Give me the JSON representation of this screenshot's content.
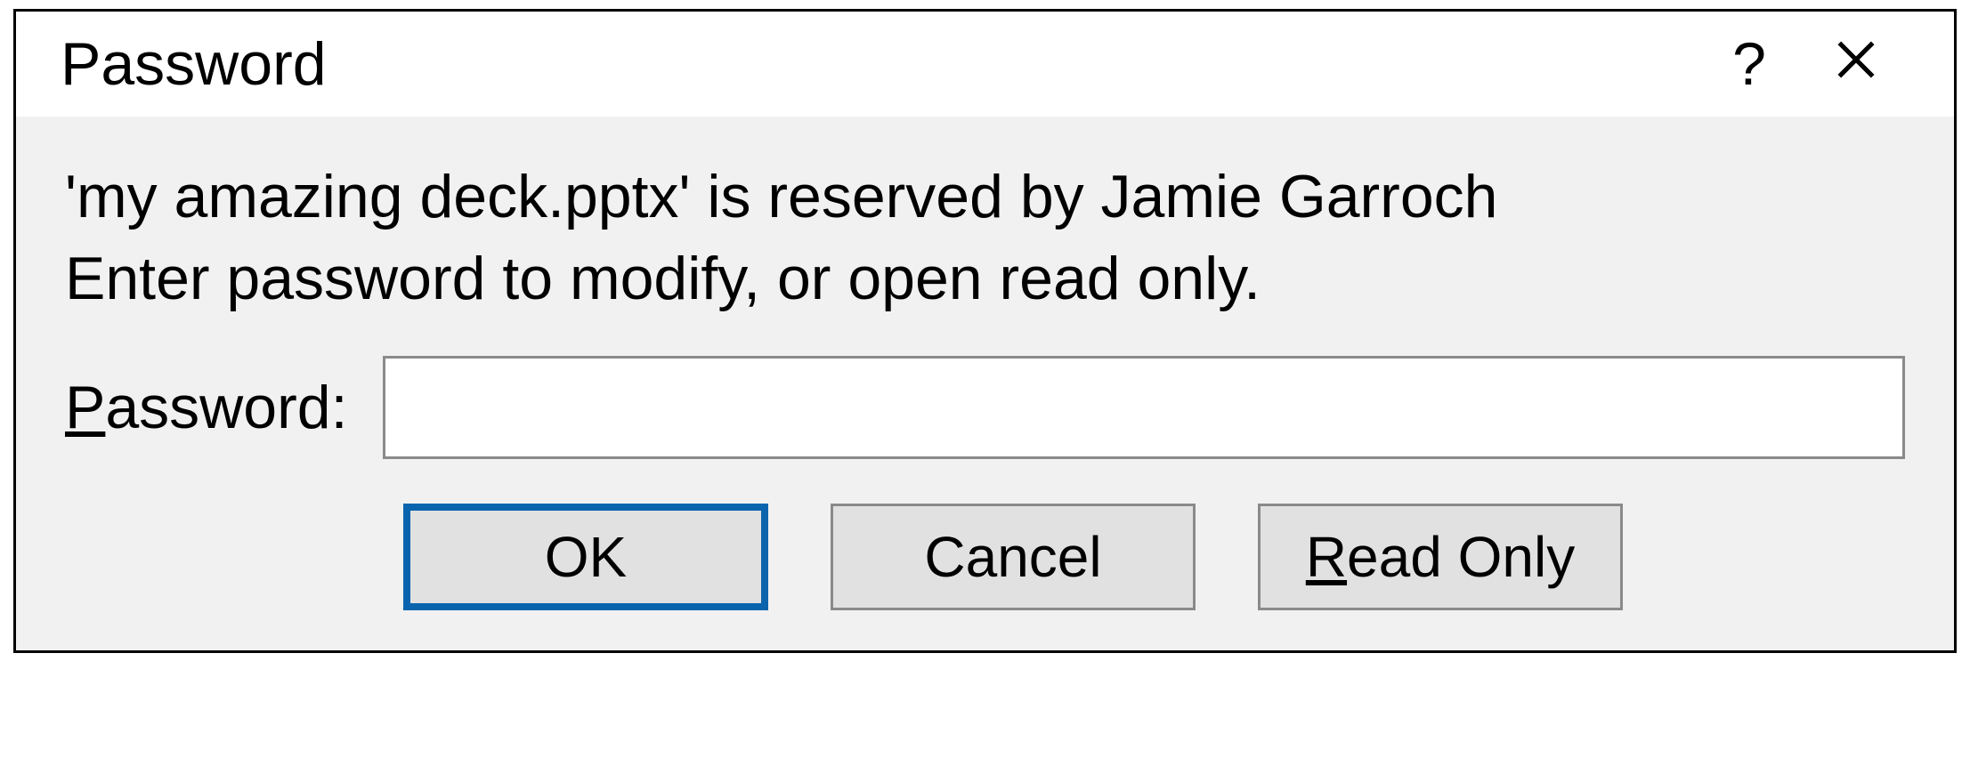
{
  "dialog": {
    "title": "Password",
    "help_glyph": "?",
    "message_line1": "'my amazing deck.pptx' is reserved by Jamie Garroch",
    "message_line2": "Enter password to modify, or open read only.",
    "password_label_accesskey": "P",
    "password_label_rest": "assword:",
    "password_value": "",
    "buttons": {
      "ok": "OK",
      "cancel": "Cancel",
      "read_only_accesskey": "R",
      "read_only_rest": "ead Only"
    }
  }
}
